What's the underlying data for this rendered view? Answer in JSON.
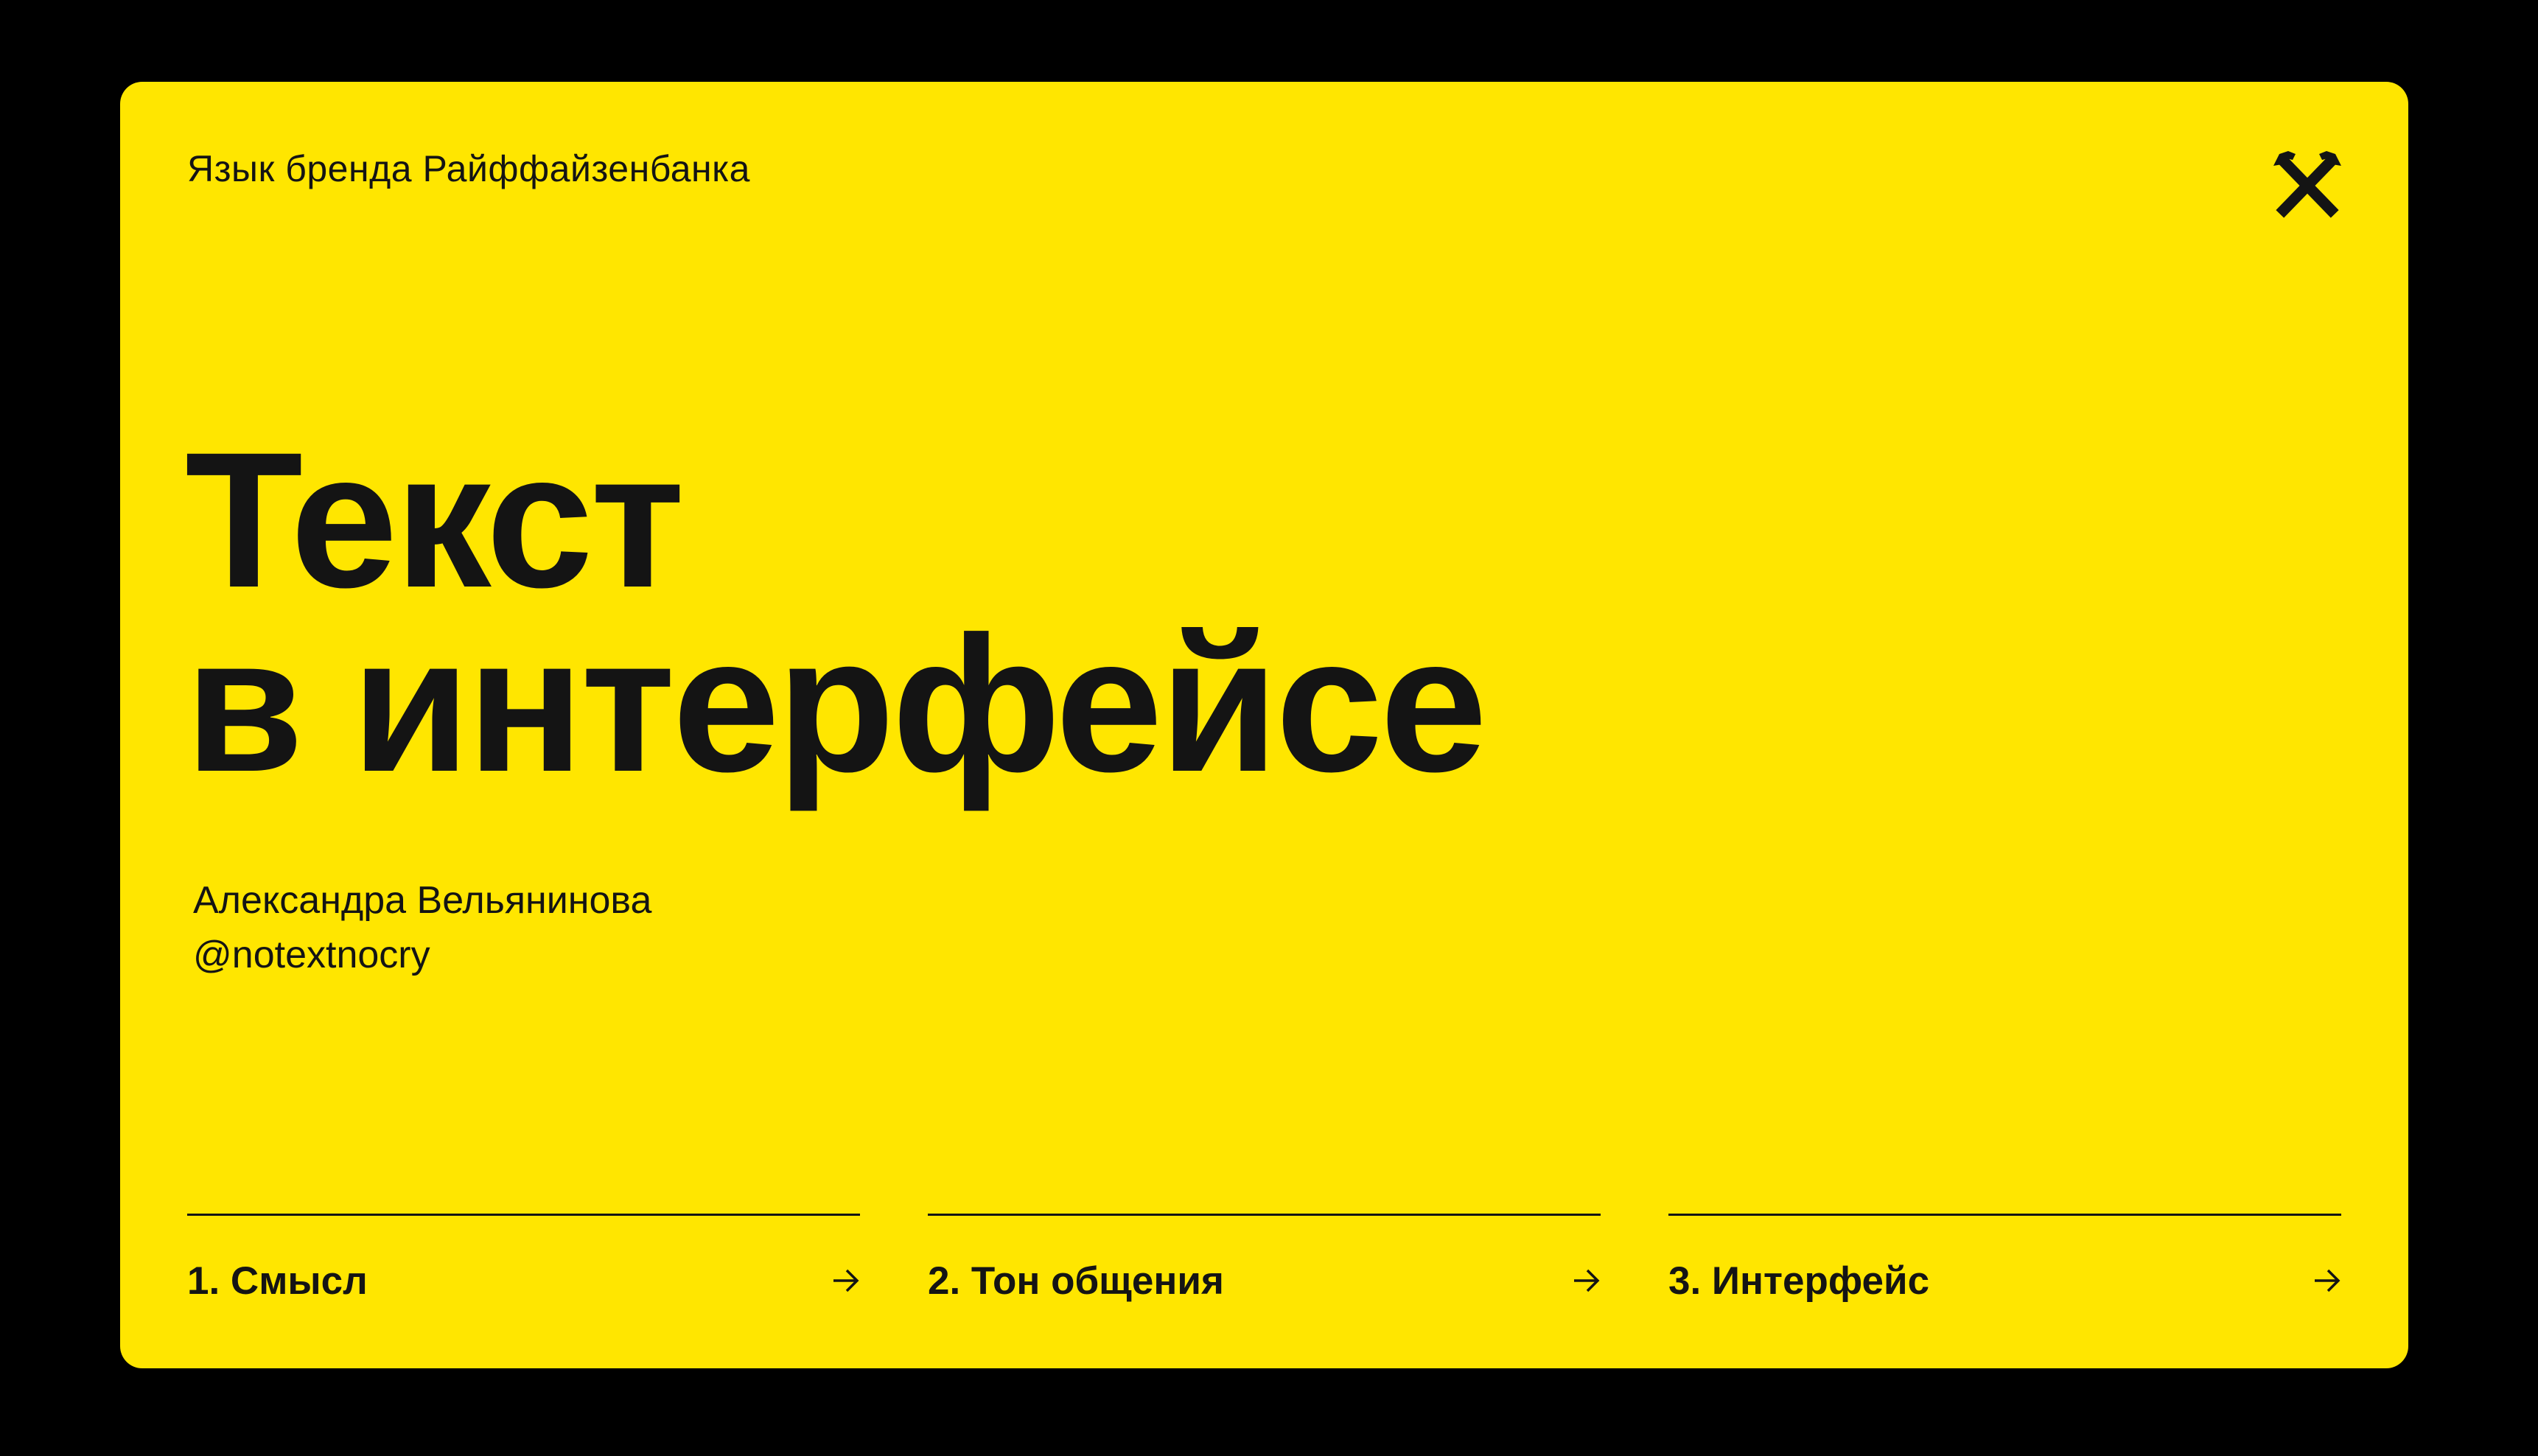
{
  "slide": {
    "brand_line": "Язык бренда Райффайзенбанка",
    "logo_icon": "raiffeisen-crossed-horses-logo",
    "title": {
      "line1": "Текст",
      "line2": "в интерфейсе"
    },
    "author": {
      "name": "Александра Вельянинова",
      "handle": "@notextnocry"
    },
    "nav": [
      {
        "label": "1. Смысл",
        "icon": "arrow-right-icon"
      },
      {
        "label": "2. Тон общения",
        "icon": "arrow-right-icon"
      },
      {
        "label": "3. Интерфейс",
        "icon": "arrow-right-icon"
      }
    ]
  },
  "colors": {
    "background": "#000000",
    "card": "#FFE600",
    "text": "#141414"
  }
}
